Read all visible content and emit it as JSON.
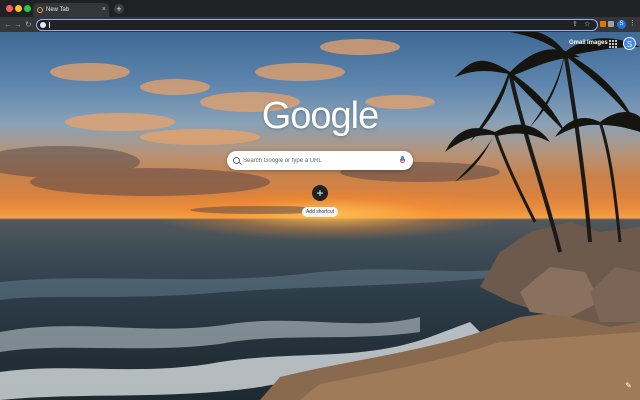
{
  "browser": {
    "tab_title": "New Tab",
    "tab_close": "×",
    "new_tab": "+",
    "nav": {
      "back": "←",
      "forward": "→",
      "reload": "↻"
    },
    "omnibox_value": "",
    "omnibox_icons": {
      "share": "⇪",
      "bookmark": "☆"
    },
    "profile_initial": "S",
    "menu": "⋮"
  },
  "header": {
    "gmail": "Gmail",
    "images": "Images",
    "avatar_initial": "S"
  },
  "logo": "Google",
  "search": {
    "placeholder": "Search Google or type a URL"
  },
  "shortcut": {
    "plus": "+",
    "label": "Add shortcut"
  },
  "customize": "✎",
  "colors": {
    "chrome_dark": "#202124",
    "toolbar": "#35363a",
    "omnibox_border": "#8ab4f8",
    "accent_blue": "#1a73e8"
  }
}
